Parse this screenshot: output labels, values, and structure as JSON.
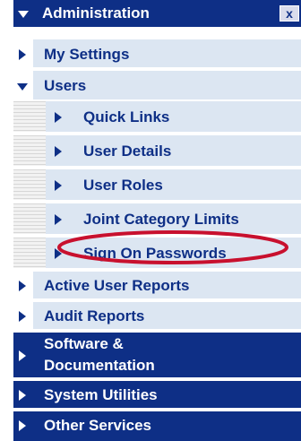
{
  "menu": {
    "administration": {
      "label": "Administration",
      "close_glyph": "x",
      "expanded": true,
      "icon": "triangle-down-icon"
    },
    "my_settings": {
      "label": "My Settings"
    },
    "users": {
      "label": "Users",
      "expanded": true,
      "items": {
        "quick_links": {
          "label": "Quick Links"
        },
        "user_details": {
          "label": "User Details"
        },
        "user_roles": {
          "label": "User Roles"
        },
        "joint_category_limits": {
          "label": "Joint Category Limits"
        },
        "sign_on_passwords": {
          "label": "Sign On Passwords",
          "highlighted": true
        }
      }
    },
    "active_user_reports": {
      "label": "Active User Reports"
    },
    "audit_reports": {
      "label": "Audit Reports"
    },
    "software_documentation": {
      "line1": "Software &",
      "line2": "Documentation"
    },
    "system_utilities": {
      "label": "System Utilities"
    },
    "other_services": {
      "label": "Other Services"
    }
  },
  "colors": {
    "navy": "#0e2f86",
    "light_row": "#dce6f2",
    "highlight_ring": "#c8102e"
  }
}
